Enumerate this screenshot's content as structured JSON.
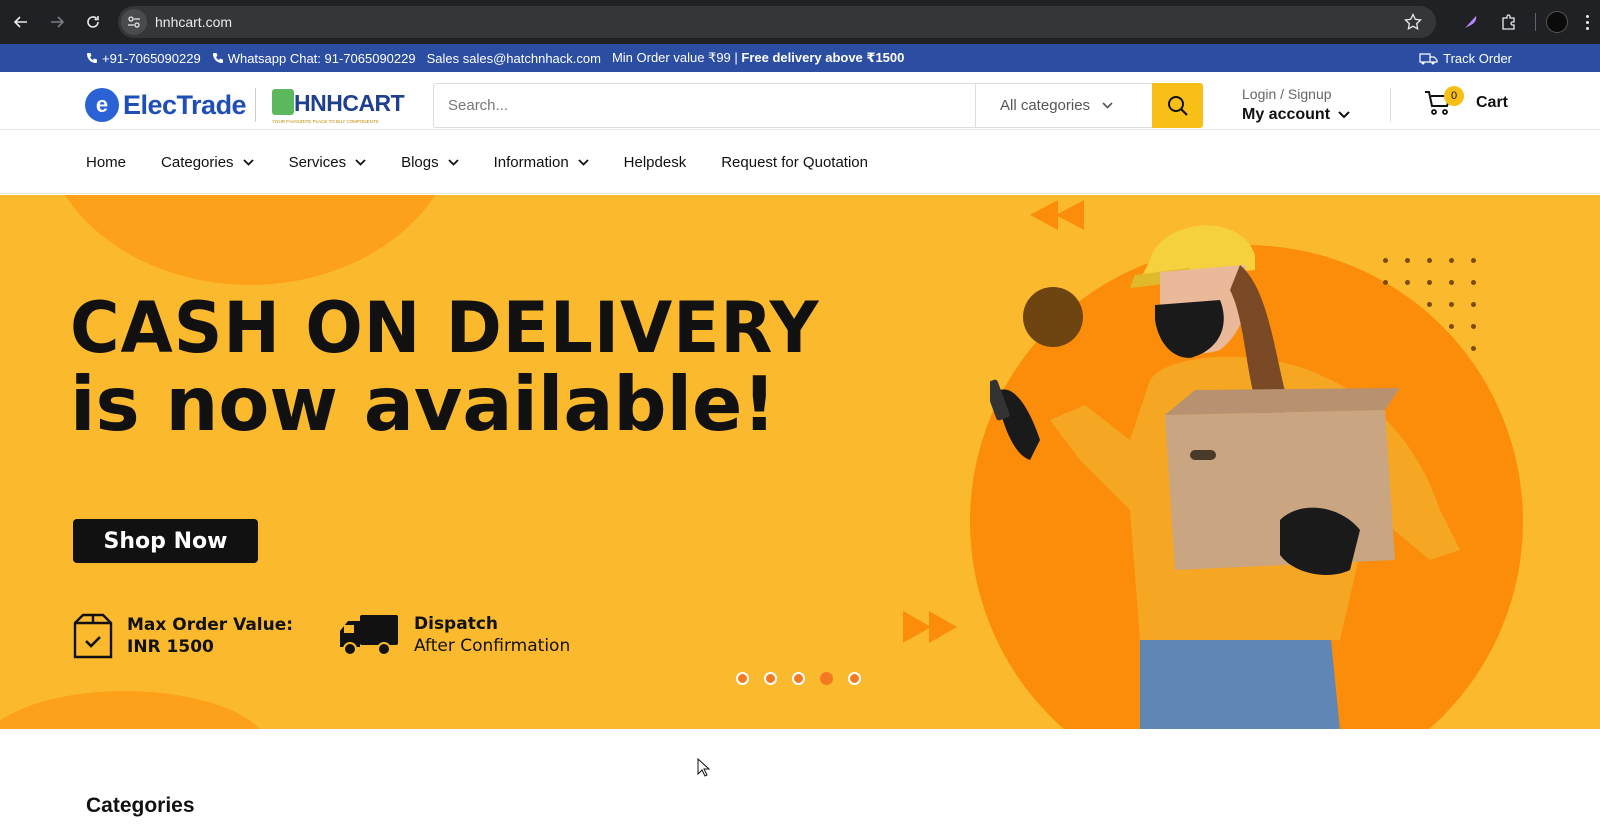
{
  "browser": {
    "url": "hnhcart.com"
  },
  "infobar": {
    "phone": "+91-7065090229",
    "whatsapp": "Whatsapp Chat: 91-7065090229",
    "sales": "Sales sales@hatchnhack.com",
    "min_order": "Min Order value ₹99 |",
    "free_delivery": "Free delivery above ₹1500",
    "track_order": "Track Order"
  },
  "header": {
    "logo_electrade": "ElecTrade",
    "logo_hnhcart": "HNHCART",
    "logo_tagline": "YOUR FAVOURITE PLACE TO BUY COMPONENTS",
    "search_placeholder": "Search...",
    "category_select": "All categories",
    "login_signup": "Login / Signup",
    "my_account": "My account",
    "cart_count": "0",
    "cart_label": "Cart"
  },
  "menu": {
    "items": [
      "Home",
      "Categories",
      "Services",
      "Blogs",
      "Information",
      "Helpdesk",
      "Request for Quotation"
    ]
  },
  "hero": {
    "title_line1": "CASH ON DELIVERY",
    "title_line2": "is now available!",
    "button": "Shop Now",
    "feature1_title": "Max Order Value:",
    "feature1_sub": "INR 1500",
    "feature2_title": "Dispatch",
    "feature2_sub": "After Confirmation",
    "slide_count": 5,
    "active_slide": 4
  },
  "sections": {
    "categories_heading": "Categories"
  },
  "colors": {
    "info_bar": "#2b4ea3",
    "accent_yellow": "#f8c016",
    "hero_bg": "#fbb92e",
    "hero_orange": "#fb8d0a"
  }
}
